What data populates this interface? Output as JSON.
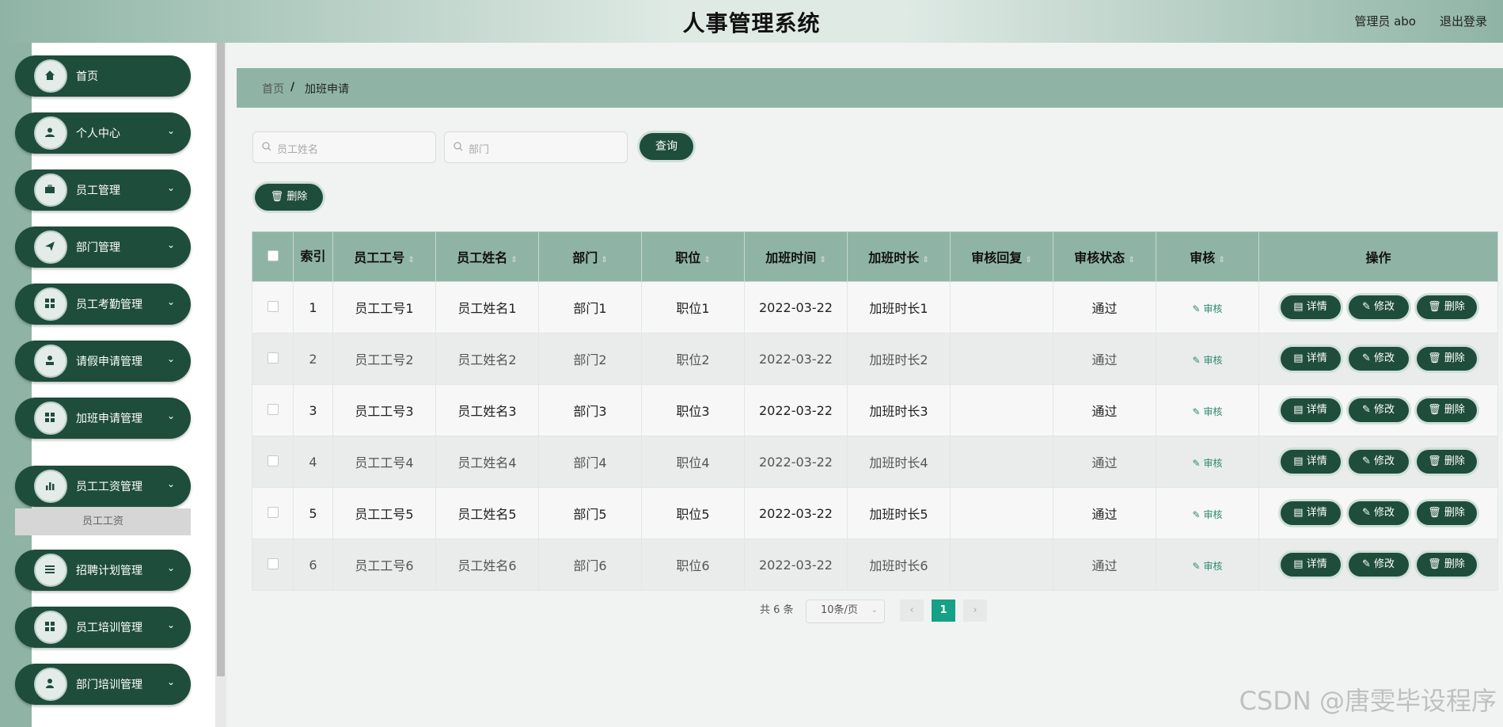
{
  "header": {
    "title": "人事管理系统",
    "user": "管理员 abo",
    "logout": "退出登录"
  },
  "sidebar": {
    "items": [
      {
        "label": "首页",
        "icon": "home-icon",
        "chevron": false
      },
      {
        "label": "个人中心",
        "icon": "user-icon",
        "chevron": true
      },
      {
        "label": "员工管理",
        "icon": "briefcase-icon",
        "chevron": true
      },
      {
        "label": "部门管理",
        "icon": "send-icon",
        "chevron": true
      },
      {
        "label": "员工考勤管理",
        "icon": "grid-icon",
        "chevron": true
      },
      {
        "label": "请假申请管理",
        "icon": "stamp-icon",
        "chevron": true
      },
      {
        "label": "加班申请管理",
        "icon": "grid-icon",
        "chevron": true
      },
      {
        "label": "员工工资管理",
        "icon": "bar-chart-icon",
        "chevron": true
      },
      {
        "label": "招聘计划管理",
        "icon": "list-icon",
        "chevron": true
      },
      {
        "label": "员工培训管理",
        "icon": "grid-icon",
        "chevron": true
      },
      {
        "label": "部门培训管理",
        "icon": "person-icon",
        "chevron": true
      }
    ],
    "submenu": "员工工资"
  },
  "breadcrumb": {
    "home": "首页",
    "sep": "/",
    "current": "加班申请"
  },
  "search": {
    "name_placeholder": "员工姓名",
    "dept_placeholder": "部门",
    "query": "查询"
  },
  "actions": {
    "delete": "删除"
  },
  "table": {
    "headers": [
      "索引",
      "员工工号",
      "员工姓名",
      "部门",
      "职位",
      "加班时间",
      "加班时长",
      "审核回复",
      "审核状态",
      "审核",
      "操作"
    ],
    "rows": [
      {
        "idx": "1",
        "no": "员工工号1",
        "name": "员工姓名1",
        "dept": "部门1",
        "pos": "职位1",
        "time": "2022-03-22",
        "dur": "加班时长1",
        "reply": "",
        "status": "通过"
      },
      {
        "idx": "2",
        "no": "员工工号2",
        "name": "员工姓名2",
        "dept": "部门2",
        "pos": "职位2",
        "time": "2022-03-22",
        "dur": "加班时长2",
        "reply": "",
        "status": "通过"
      },
      {
        "idx": "3",
        "no": "员工工号3",
        "name": "员工姓名3",
        "dept": "部门3",
        "pos": "职位3",
        "time": "2022-03-22",
        "dur": "加班时长3",
        "reply": "",
        "status": "通过"
      },
      {
        "idx": "4",
        "no": "员工工号4",
        "name": "员工姓名4",
        "dept": "部门4",
        "pos": "职位4",
        "time": "2022-03-22",
        "dur": "加班时长4",
        "reply": "",
        "status": "通过"
      },
      {
        "idx": "5",
        "no": "员工工号5",
        "name": "员工姓名5",
        "dept": "部门5",
        "pos": "职位5",
        "time": "2022-03-22",
        "dur": "加班时长5",
        "reply": "",
        "status": "通过"
      },
      {
        "idx": "6",
        "no": "员工工号6",
        "name": "员工姓名6",
        "dept": "部门6",
        "pos": "职位6",
        "time": "2022-03-22",
        "dur": "加班时长6",
        "reply": "",
        "status": "通过"
      }
    ],
    "audit_link": "审核",
    "op_detail": "详情",
    "op_edit": "修改",
    "op_delete": "删除"
  },
  "pagination": {
    "total": "共 6 条",
    "page_size": "10条/页",
    "current_page": "1"
  },
  "watermark": "CSDN @唐雯毕设程序",
  "colors": {
    "accent_dark": "#1f4d3c",
    "accent_light": "#8fb4a6",
    "page_active": "#16a086"
  }
}
